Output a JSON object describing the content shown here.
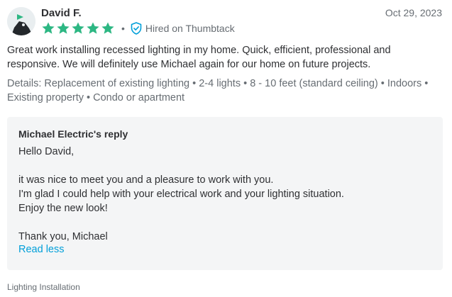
{
  "reviewer": {
    "name": "David F.",
    "date": "Oct 29, 2023",
    "rating": 5,
    "hired_label": "Hired on Thumbtack",
    "separator": "•"
  },
  "review": {
    "text": "Great work installing recessed lighting in my home. Quick, efficient, professional and responsive. We will definitely use Michael again for our home on future projects.",
    "details": "Details: Replacement of existing lighting • 2-4 lights • 8 - 10 feet (standard ceiling) • Indoors • Existing property • Condo or apartment"
  },
  "reply": {
    "title": "Michael Electric's reply",
    "lines": [
      "Hello David,",
      "",
      "it was nice to meet you and a pleasure to work with you.",
      "I'm glad I could help with your electrical work and your lighting situation.",
      "Enjoy the new look!",
      "",
      "Thank you, Michael"
    ],
    "read_less_label": "Read less"
  },
  "category": "Lighting Installation",
  "icons": {
    "avatar": "avatar-icon",
    "star": "star-icon",
    "shield": "shield-check-icon"
  },
  "colors": {
    "star_green": "#2db783",
    "link_blue": "#009fd9",
    "shield_blue": "#009fd9",
    "muted_text": "#676d73",
    "reply_bg": "#f4f5f6"
  }
}
